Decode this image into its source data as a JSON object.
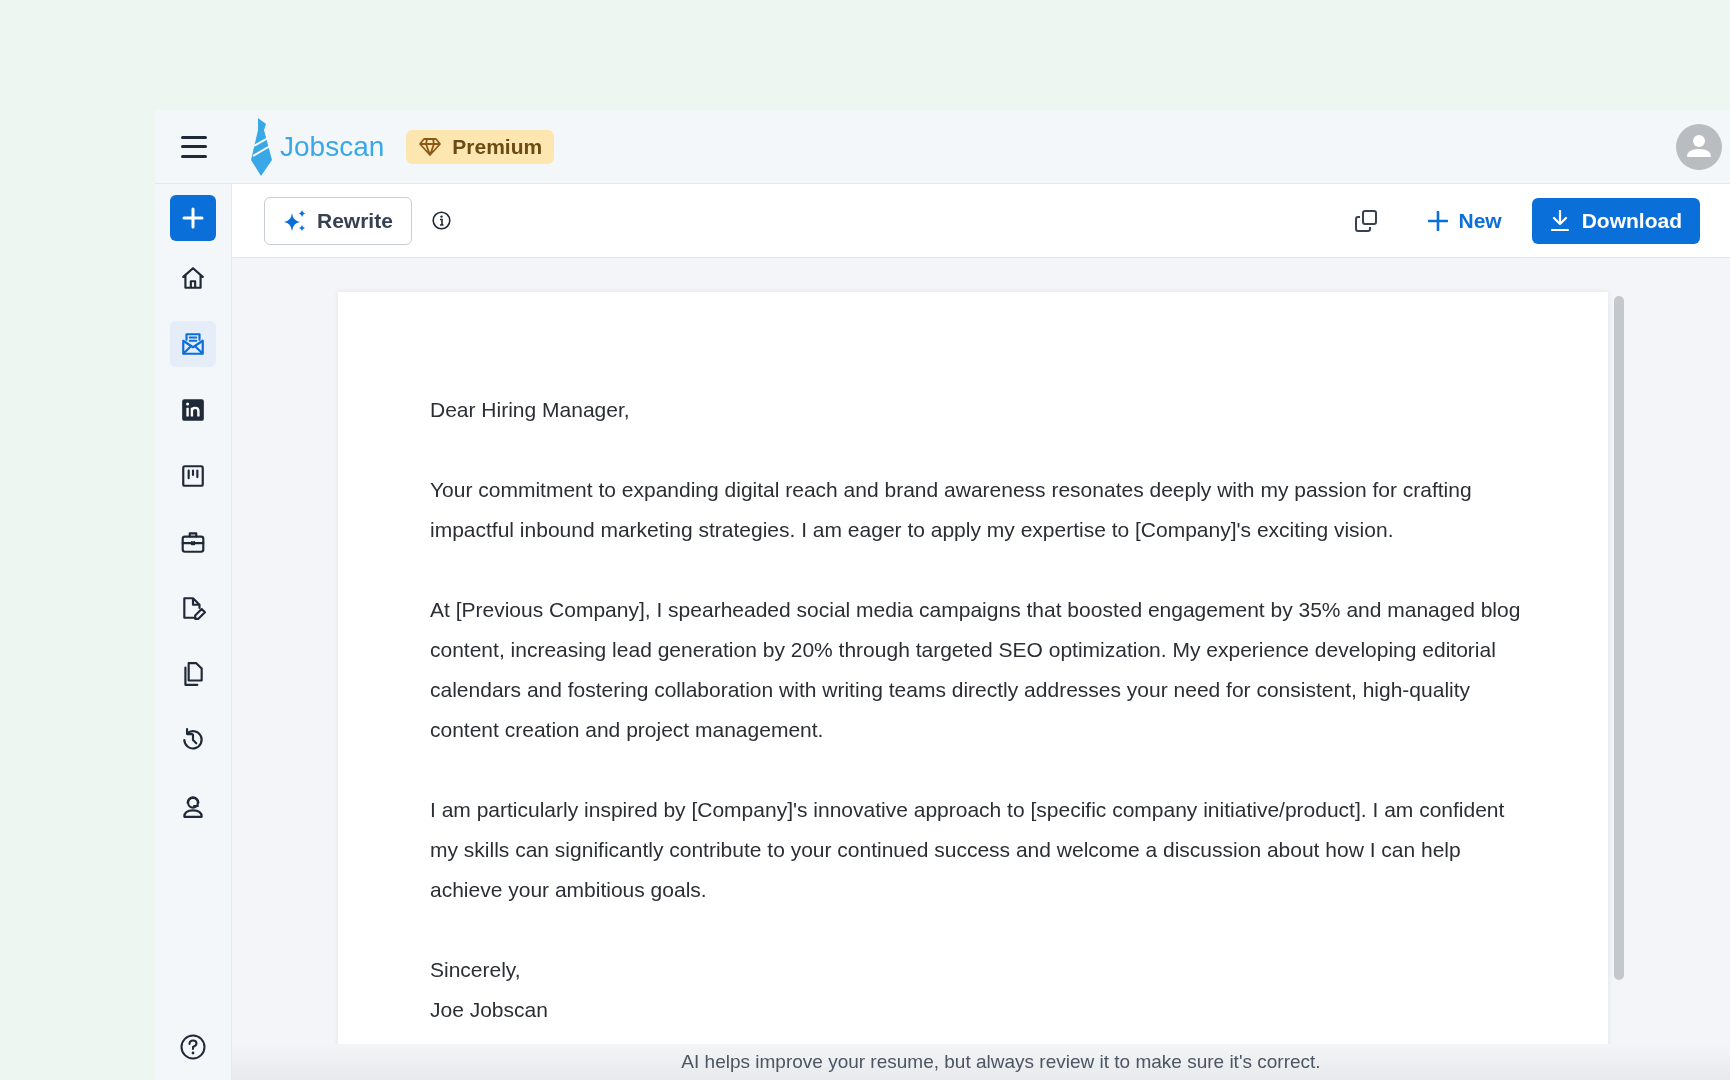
{
  "header": {
    "logo": "Jobscan",
    "badge": "Premium"
  },
  "sidebar": {
    "items": [
      {
        "kind": "home",
        "selected": false
      },
      {
        "kind": "mail",
        "selected": true
      },
      {
        "kind": "linkedin",
        "selected": false
      },
      {
        "kind": "board",
        "selected": false
      },
      {
        "kind": "briefcase",
        "selected": false
      },
      {
        "kind": "edit",
        "selected": false
      },
      {
        "kind": "copy",
        "selected": false
      },
      {
        "kind": "history",
        "selected": false
      },
      {
        "kind": "support",
        "selected": false
      }
    ]
  },
  "toolbar": {
    "rewrite": "Rewrite",
    "new": "New",
    "download": "Download"
  },
  "letter": {
    "blocks": [
      [
        "Dear Hiring Manager,"
      ],
      [
        "Your commitment to expanding digital reach and brand awareness resonates deeply with my passion for crafting impactful inbound marketing strategies. I am eager to apply my expertise to [Company]'s exciting vision."
      ],
      [
        "At [Previous Company], I spearheaded social media campaigns that boosted engagement by 35% and managed blog content, increasing lead generation by 20% through targeted SEO optimization. My experience developing editorial calendars and fostering collaboration with writing teams directly addresses your need for consistent, high-quality content creation and project management."
      ],
      [
        "I am particularly inspired by [Company]'s innovative approach to [specific company initiative/product]. I am confident my skills can significantly contribute to your continued success and welcome a discussion about how I can help achieve your ambitious goals."
      ],
      [
        "Sincerely,",
        "Joe Jobscan"
      ]
    ]
  },
  "footer": "AI helps improve your resume, but always review it to make sure it's correct."
}
